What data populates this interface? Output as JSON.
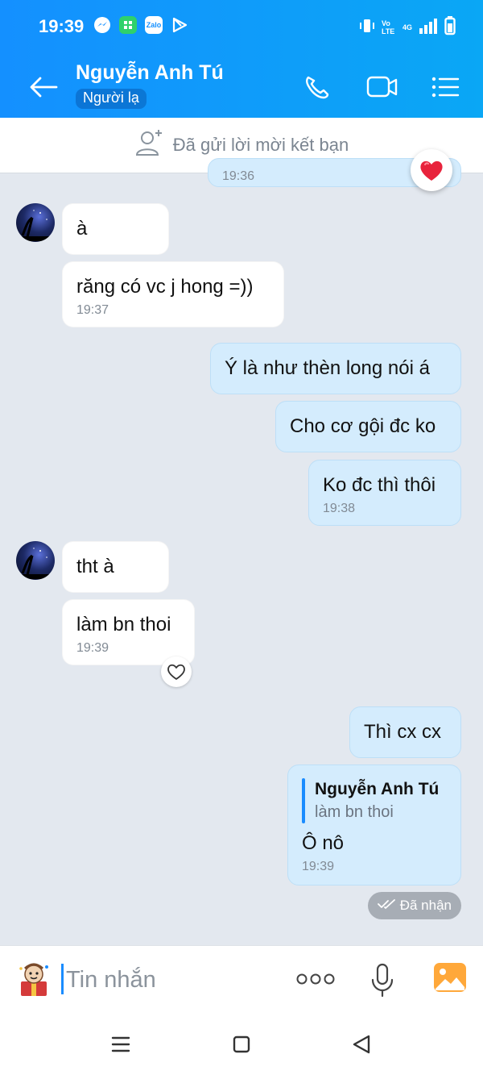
{
  "status_bar": {
    "time": "19:39",
    "network_label": "4G",
    "volte_label": "Vo LTE",
    "zalo_label": "Zalo"
  },
  "header": {
    "contact_name": "Nguyễn Anh Tú",
    "contact_tag": "Người lạ"
  },
  "friend_request": {
    "text": "Đã gửi lời mời kết bạn"
  },
  "messages": [
    {
      "text": "19:36"
    },
    {
      "text": "à"
    },
    {
      "text": "răng có vc j hong =))",
      "time": "19:37"
    },
    {
      "text": "Ý là như thèn long nói á"
    },
    {
      "text": "Cho cơ gội đc ko"
    },
    {
      "text": "Ko đc thì thôi",
      "time": "19:38"
    },
    {
      "text": "tht à"
    },
    {
      "text": "làm bn thoi",
      "time": "19:39"
    },
    {
      "text": "Thì cx cx"
    },
    {
      "quote_name": "Nguyễn Anh Tú",
      "quote_text": "làm bn thoi",
      "text": "Ô nô",
      "time": "19:39"
    }
  ],
  "delivery_status": "Đã nhận",
  "composer": {
    "placeholder": "Tin nhắn"
  },
  "colors": {
    "header": "#1490ff",
    "sent_bubble": "#d4ecfd",
    "received_bubble": "#ffffff",
    "background": "#e3e8ef",
    "accent": "#1a8cff"
  }
}
